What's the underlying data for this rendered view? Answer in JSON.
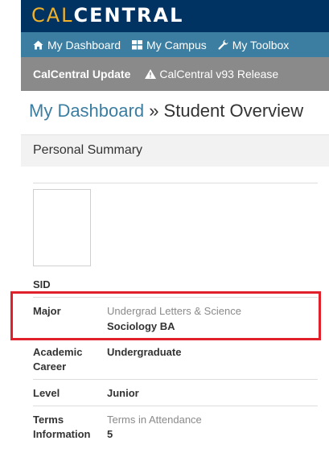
{
  "logo": {
    "part1": "CAL",
    "part2": "CENTRAL"
  },
  "nav": [
    {
      "label": "My Dashboard",
      "icon": "home-icon"
    },
    {
      "label": "My Campus",
      "icon": "grid-icon"
    },
    {
      "label": "My Toolbox",
      "icon": "wrench-icon"
    }
  ],
  "alert": {
    "title": "CalCentral Update",
    "message": "CalCentral v93 Release",
    "icon": "warning-icon"
  },
  "breadcrumb": {
    "link": "My Dashboard",
    "separator": " » ",
    "current": "Student Overview"
  },
  "card": {
    "title": "Personal Summary"
  },
  "summary": {
    "sid_label": "SID",
    "major_label": "Major",
    "major_college": "Undergrad Letters & Science",
    "major_value": "Sociology BA",
    "career_label": "Academic Career",
    "career_value": "Undergraduate",
    "level_label": "Level",
    "level_value": "Junior",
    "terms_label": "Terms Information",
    "terms_sub": "Terms in Attendance",
    "terms_value": "5"
  },
  "colors": {
    "brand_navy": "#003262",
    "brand_gold": "#f2b227",
    "nav_blue": "#3b7ea1",
    "alert_gray": "#8a8a8a",
    "highlight_red": "#e0202b"
  }
}
